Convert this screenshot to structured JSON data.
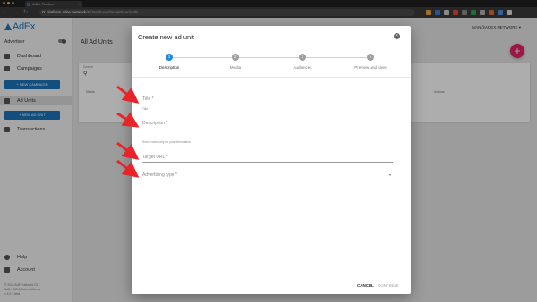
{
  "browser": {
    "tab_title": "AdEx Platform",
    "tab_close": "×",
    "url_host": "platform.adex.network",
    "url_path": "/#/dashboard/advertiser/units",
    "nav": {
      "back": "←",
      "forward": "→",
      "reload": "↻"
    },
    "window_dot_colors": [
      "#fc605c",
      "#fdbc40",
      "#34c84a"
    ],
    "extension_colors": [
      "#f2a33a",
      "#3a7bd5",
      "#cccccc",
      "#e8453c",
      "#8c8c8c",
      "#2ea44f",
      "#b0b0b0",
      "#e06a2c",
      "#4a90e2",
      "#dddddd"
    ]
  },
  "sidebar": {
    "logo": "AdEx",
    "role": "Advertiser",
    "items": [
      {
        "label": "Dashboard",
        "icon": "dashboard-icon"
      },
      {
        "label": "Campaigns",
        "icon": "campaigns-icon"
      },
      {
        "label": "Ad Units",
        "icon": "ad-units-icon"
      },
      {
        "label": "Transactions",
        "icon": "transactions-icon"
      }
    ],
    "new_campaign": "+ NEW CAMPAIGN",
    "new_ad_unit": "+ NEW AD UNIT",
    "help": "Help",
    "account": "Account",
    "footer": [
      "© 2019 AdEx Network OÜ",
      "AdEx (ADX) Token Address",
      "v 4.0.1 beta"
    ]
  },
  "main": {
    "account_label": "IVAN@ADEX.NETWORK ▾",
    "page_title": "All Ad Units",
    "search_label": "Search",
    "search_icon": "⚲",
    "fab": "+",
    "columns": [
      "Media",
      "Actions"
    ]
  },
  "dialog": {
    "title": "Create new ad unit",
    "close": "×",
    "steps": [
      {
        "num": "1",
        "label": "Description"
      },
      {
        "num": "2",
        "label": "Media"
      },
      {
        "num": "3",
        "label": "Audiences"
      },
      {
        "num": "4",
        "label": "Preview and save"
      }
    ],
    "fields": {
      "title_label": "Title *",
      "title_help": "Title",
      "description_label": "Description *",
      "description_help": "Some notes only for your information",
      "target_url_label": "Target URL *",
      "ad_type_label": "Advertising type *",
      "ad_type_arrow": "▾"
    },
    "cancel": "CANCEL",
    "continue": "CONTINUE"
  },
  "colors": {
    "accent": "#1b75bc",
    "fab": "#e5226b",
    "arrow": "#e8232a",
    "step_active": "#1e88e5",
    "step_inactive": "#9e9e9e"
  }
}
